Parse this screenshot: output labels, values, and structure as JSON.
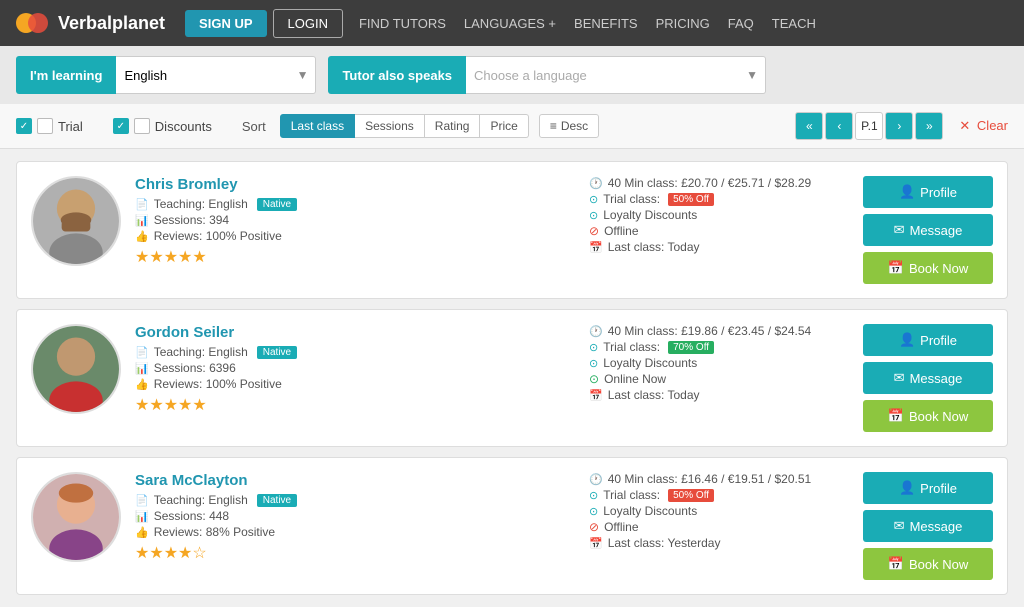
{
  "nav": {
    "logo_text": "Verbalplanet",
    "signup": "SIGN UP",
    "login": "LOGIN",
    "links": [
      "FIND TUTORS",
      "LANGUAGES +",
      "BENEFITS",
      "PRICING",
      "FAQ",
      "TEACH"
    ]
  },
  "search": {
    "learning_label": "I'm learning",
    "learning_value": "English",
    "tutor_label": "Tutor also speaks",
    "tutor_placeholder": "Choose a language"
  },
  "filters": {
    "trial_label": "Trial",
    "discounts_label": "Discounts",
    "sort_label": "Sort",
    "sort_options": [
      "Last class",
      "Sessions",
      "Rating",
      "Price"
    ],
    "active_sort": "Last class",
    "order_label": "Desc",
    "page_label": "P.1",
    "clear_label": "Clear"
  },
  "tutors": [
    {
      "name": "Chris Bromley",
      "teaching": "English",
      "native": true,
      "sessions": "394",
      "reviews": "100% Positive",
      "stars": 5,
      "price": "40 Min class: £20.70 / €25.71 / $28.29",
      "trial": "Trial class: 50% Off",
      "trial_color": "red",
      "loyalty": "Loyalty Discounts",
      "status": "Offline",
      "status_type": "offline",
      "last_class": "Last class: Today",
      "avatar_seed": "1"
    },
    {
      "name": "Gordon Seiler",
      "teaching": "English",
      "native": true,
      "sessions": "6396",
      "reviews": "100% Positive",
      "stars": 5,
      "price": "40 Min class: £19.86 / €23.45 / $24.54",
      "trial": "Trial class: 70% Off",
      "trial_color": "green",
      "loyalty": "Loyalty Discounts",
      "status": "Online Now",
      "status_type": "online",
      "last_class": "Last class: Today",
      "avatar_seed": "2"
    },
    {
      "name": "Sara McClayton",
      "teaching": "English",
      "native": true,
      "sessions": "448",
      "reviews": "88% Positive",
      "stars": 4,
      "price": "40 Min class: £16.46 / €19.51 / $20.51",
      "trial": "Trial class: 50% Off",
      "trial_color": "red",
      "loyalty": "Loyalty Discounts",
      "status": "Offline",
      "status_type": "offline",
      "last_class": "Last class: Yesterday",
      "avatar_seed": "3"
    }
  ],
  "buttons": {
    "profile": "Profile",
    "message": "Message",
    "book": "Book Now"
  }
}
